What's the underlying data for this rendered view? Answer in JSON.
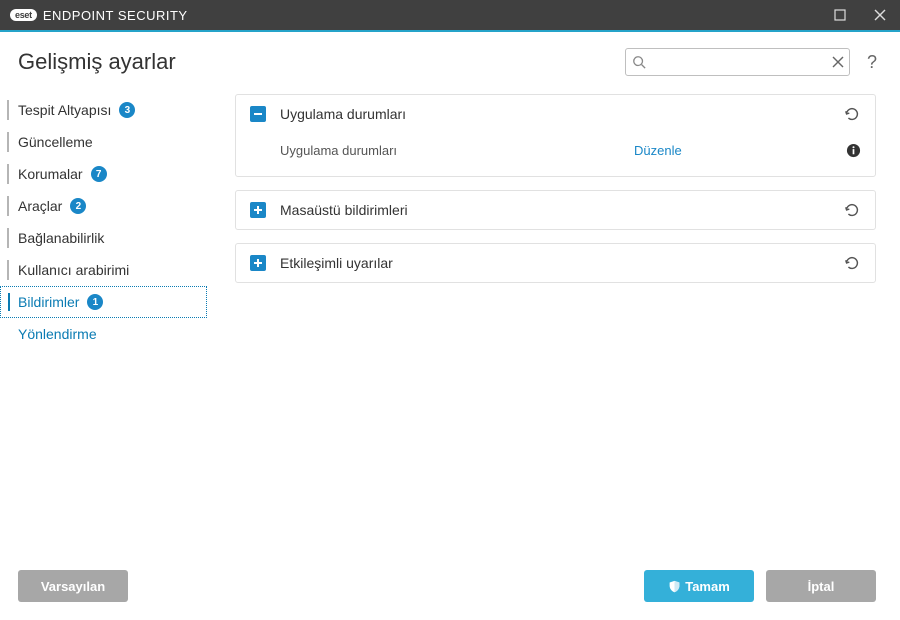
{
  "titlebar": {
    "logo_text": "eset",
    "product": "ENDPOINT SECURITY"
  },
  "header": {
    "title": "Gelişmiş ayarlar",
    "search_placeholder": ""
  },
  "sidebar": {
    "items": [
      {
        "label": "Tespit Altyapısı",
        "badge": "3"
      },
      {
        "label": "Güncelleme",
        "badge": null
      },
      {
        "label": "Korumalar",
        "badge": "7"
      },
      {
        "label": "Araçlar",
        "badge": "2"
      },
      {
        "label": "Bağlanabilirlik",
        "badge": null
      },
      {
        "label": "Kullanıcı arabirimi",
        "badge": null
      },
      {
        "label": "Bildirimler",
        "badge": "1"
      }
    ],
    "sub": {
      "label": "Yönlendirme"
    }
  },
  "panels": {
    "p0": {
      "title": "Uygulama durumları",
      "row_label": "Uygulama durumları",
      "row_link": "Düzenle"
    },
    "p1": {
      "title": "Masaüstü bildirimleri"
    },
    "p2": {
      "title": "Etkileşimli uyarılar"
    }
  },
  "footer": {
    "default_btn": "Varsayılan",
    "ok_btn": "Tamam",
    "cancel_btn": "İptal"
  }
}
